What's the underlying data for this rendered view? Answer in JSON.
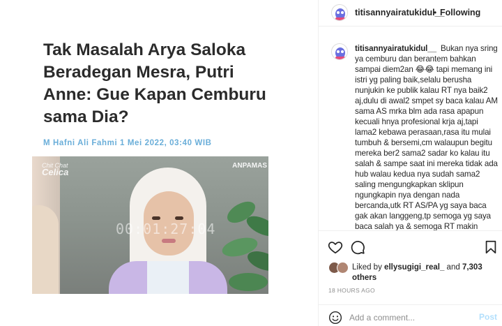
{
  "article": {
    "headline": "Tak Masalah Arya Saloka Beradegan Mesra, Putri Anne: Gue Kapan Cemburu sama Dia?",
    "byline": "M Hafni Ali Fahmi 1 Mei 2022, 03:40 WIB",
    "video": {
      "show_logo_small": "Chit Chat",
      "show_logo_big": "Celica",
      "channel_logo": "ANPAMAS",
      "timecode": "00:01:27:04"
    }
  },
  "post": {
    "username": "titisannyairatukidul__",
    "separator": "•",
    "follow_label": "Following",
    "caption": "Bukan nya sring ya cemburu dan berantem bahkan sampai diem2an 😂😂 tapi memang ini istri yg paling baik,selalu berusha nunjukin ke publik kalau RT nya baik2 aj,dulu di awal2 smpet sy baca kalau AM sama AS mrka blm ada rasa apapun kecuali hnya profesional krja aj,tapi lama2 kebawa perasaan,rasa itu mulai tumbuh & bersemi,cm walaupun begitu mereka ber2 sama2 sadar ko kalau itu salah & sampe saat ini mereka tidak ada hub walau kedua nya sudah sama2 saling mengungkapkan sklipun ngungkapin nya dengan nada bercanda,utk RT AS/PA yg saya baca gak akan langgeng,tp semoga yg saya baca salah ya & semoga RT makin bahagia kedepan nya karna PA istri yg sangat baik hati 🙏",
    "liked_by_prefix": "Liked by",
    "liked_by_user": "ellysugigi_real_",
    "liked_by_and": "and",
    "others_count": "7,303 others",
    "timestamp": "18 HOURS AGO"
  },
  "icons": {
    "like": "heart-icon",
    "comment": "comment-icon",
    "save": "bookmark-icon",
    "emoji": "emoji-icon"
  },
  "comment_box": {
    "placeholder": "Add a comment...",
    "post_label": "Post"
  },
  "colors": {
    "byline": "#6aaed9",
    "post_button_disabled": "#b2dffc",
    "secondary_text": "#8e8e8e",
    "border": "#efefef"
  }
}
